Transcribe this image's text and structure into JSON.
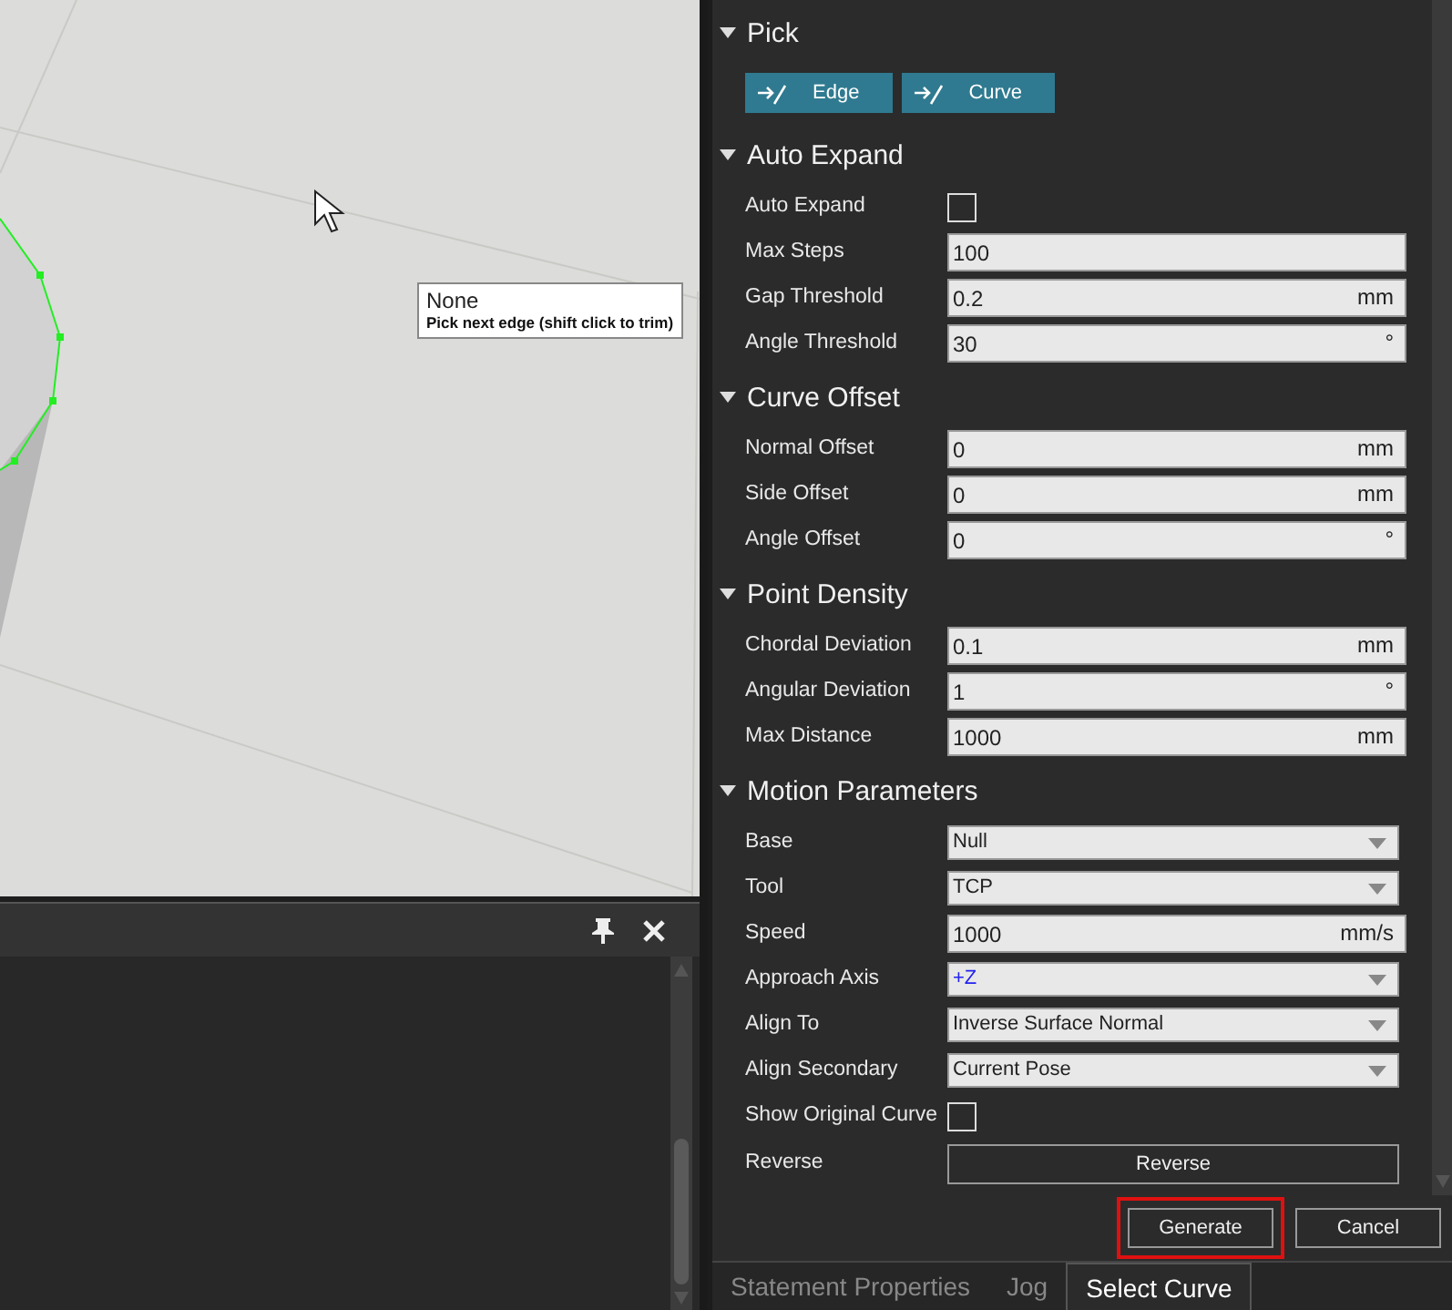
{
  "viewport": {
    "tooltip": {
      "title": "None",
      "hint": "Pick next edge (shift click to trim)"
    }
  },
  "sections": [
    {
      "title": "Pick",
      "expanded": true,
      "rows": [
        {
          "kind": "pickbuttons",
          "buttons": [
            "Edge",
            "Curve"
          ]
        }
      ]
    },
    {
      "title": "Auto Expand",
      "expanded": true,
      "rows": [
        {
          "kind": "checkbox",
          "label": "Auto Expand",
          "checked": false
        },
        {
          "kind": "text",
          "label": "Max Steps",
          "value": "100"
        },
        {
          "kind": "text",
          "label": "Gap Threshold",
          "value": "0.2",
          "unit": "mm"
        },
        {
          "kind": "text",
          "label": "Angle Threshold",
          "value": "30",
          "unit": "°"
        }
      ]
    },
    {
      "title": "Curve Offset",
      "expanded": true,
      "rows": [
        {
          "kind": "text",
          "label": "Normal Offset",
          "value": "0",
          "unit": "mm"
        },
        {
          "kind": "text",
          "label": "Side Offset",
          "value": "0",
          "unit": "mm"
        },
        {
          "kind": "text",
          "label": "Angle Offset",
          "value": "0",
          "unit": "°"
        }
      ]
    },
    {
      "title": "Point Density",
      "expanded": true,
      "rows": [
        {
          "kind": "text",
          "label": "Chordal Deviation",
          "value": "0.1",
          "unit": "mm"
        },
        {
          "kind": "text",
          "label": "Angular Deviation",
          "value": "1",
          "unit": "°"
        },
        {
          "kind": "text",
          "label": "Max Distance",
          "value": "1000",
          "unit": "mm"
        }
      ]
    },
    {
      "title": "Motion Parameters",
      "expanded": true,
      "rows": [
        {
          "kind": "dropdown",
          "label": "Base",
          "value": "Null"
        },
        {
          "kind": "dropdown",
          "label": "Tool",
          "value": "TCP"
        },
        {
          "kind": "text",
          "label": "Speed",
          "value": "1000",
          "unit": "mm/s"
        },
        {
          "kind": "dropdown",
          "label": "Approach Axis",
          "value": "+Z",
          "color": "#2222ee"
        },
        {
          "kind": "dropdown",
          "label": "Align To",
          "value": "Inverse Surface Normal"
        },
        {
          "kind": "dropdown",
          "label": "Align Secondary",
          "value": "Current Pose"
        },
        {
          "kind": "checkbox",
          "label": "Show Original Curve",
          "checked": false
        },
        {
          "kind": "button",
          "label": "Reverse",
          "button": "Reverse"
        }
      ]
    }
  ],
  "actions": [
    {
      "label": "Generate",
      "highlighted": true
    },
    {
      "label": "Cancel",
      "highlighted": false
    }
  ],
  "tabs": [
    {
      "label": "Statement Properties",
      "selected": false
    },
    {
      "label": "Jog",
      "selected": false
    },
    {
      "label": "Select Curve",
      "selected": true
    }
  ]
}
